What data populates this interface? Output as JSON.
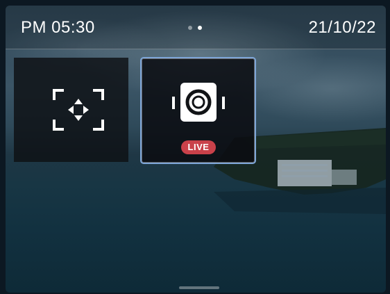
{
  "status_bar": {
    "time": "PM 05:30",
    "date": "21/10/22",
    "page_indicator": {
      "total": 2,
      "active_index": 1
    }
  },
  "tiles": [
    {
      "name": "scan",
      "icon": "scan-frame-icon",
      "selected": false
    },
    {
      "name": "live-camera",
      "icon": "camera-icon",
      "badge": "LIVE",
      "selected": true
    }
  ],
  "colors": {
    "selection_border": "#7ea6d8",
    "live_badge": "#c9414a",
    "tile_background": "#0e1014"
  }
}
